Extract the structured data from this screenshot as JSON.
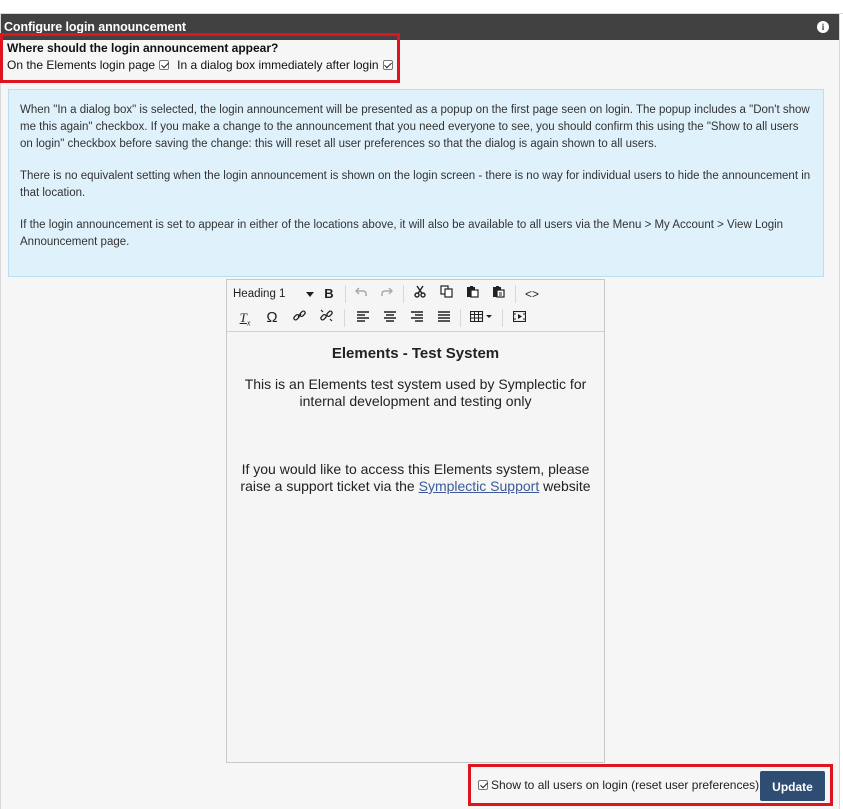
{
  "panel": {
    "title": "Configure login announcement",
    "info_icon": "i"
  },
  "where": {
    "title": "Where should the login announcement appear?",
    "option_login_page": "On the Elements login page",
    "option_login_page_checked": true,
    "option_dialog": "In a dialog box immediately after login",
    "option_dialog_checked": true
  },
  "info": {
    "p1": "When \"In a dialog box\" is selected, the login announcement will be presented as a popup on the first page seen on login. The popup includes a \"Don't show me this again\" checkbox. If you make a change to the announcement that you need everyone to see, you should confirm this using the \"Show to all users on login\" checkbox before saving the change: this will reset all user preferences so that the dialog is again shown to all users.",
    "p2": "There is no equivalent setting when the login announcement is shown on the login screen - there is no way for individual users to hide the announcement in that location.",
    "p3": "If the login announcement is set to appear in either of the locations above, it will also be available to all users via the Menu > My Account > View Login Announcement page."
  },
  "editor": {
    "format_select": "Heading 1",
    "toolbar_row1": [
      "bold",
      "undo",
      "redo",
      "cut",
      "copy",
      "paste",
      "paste-text",
      "source-code"
    ],
    "toolbar_row2": [
      "clear-formatting",
      "special-character",
      "link",
      "unlink",
      "align-left",
      "align-center",
      "align-right",
      "justify",
      "table",
      "media"
    ],
    "heading": "Elements - Test System",
    "para1": "This is an Elements test system used by Symplectic for internal development and testing only",
    "para2_before": "If you would like to access this Elements system, please raise a support ticket via the ",
    "para2_link": "Symplectic Support",
    "para2_after": " website"
  },
  "footer": {
    "show_all_label": "Show to all users on login (reset user preferences)",
    "show_all_checked": true,
    "update_label": "Update"
  },
  "colors": {
    "header_bg": "#414141",
    "highlight_border": "#e0141e",
    "info_bg": "#dff1fa",
    "button_bg": "#2f4d73",
    "link": "#3c5a98"
  }
}
